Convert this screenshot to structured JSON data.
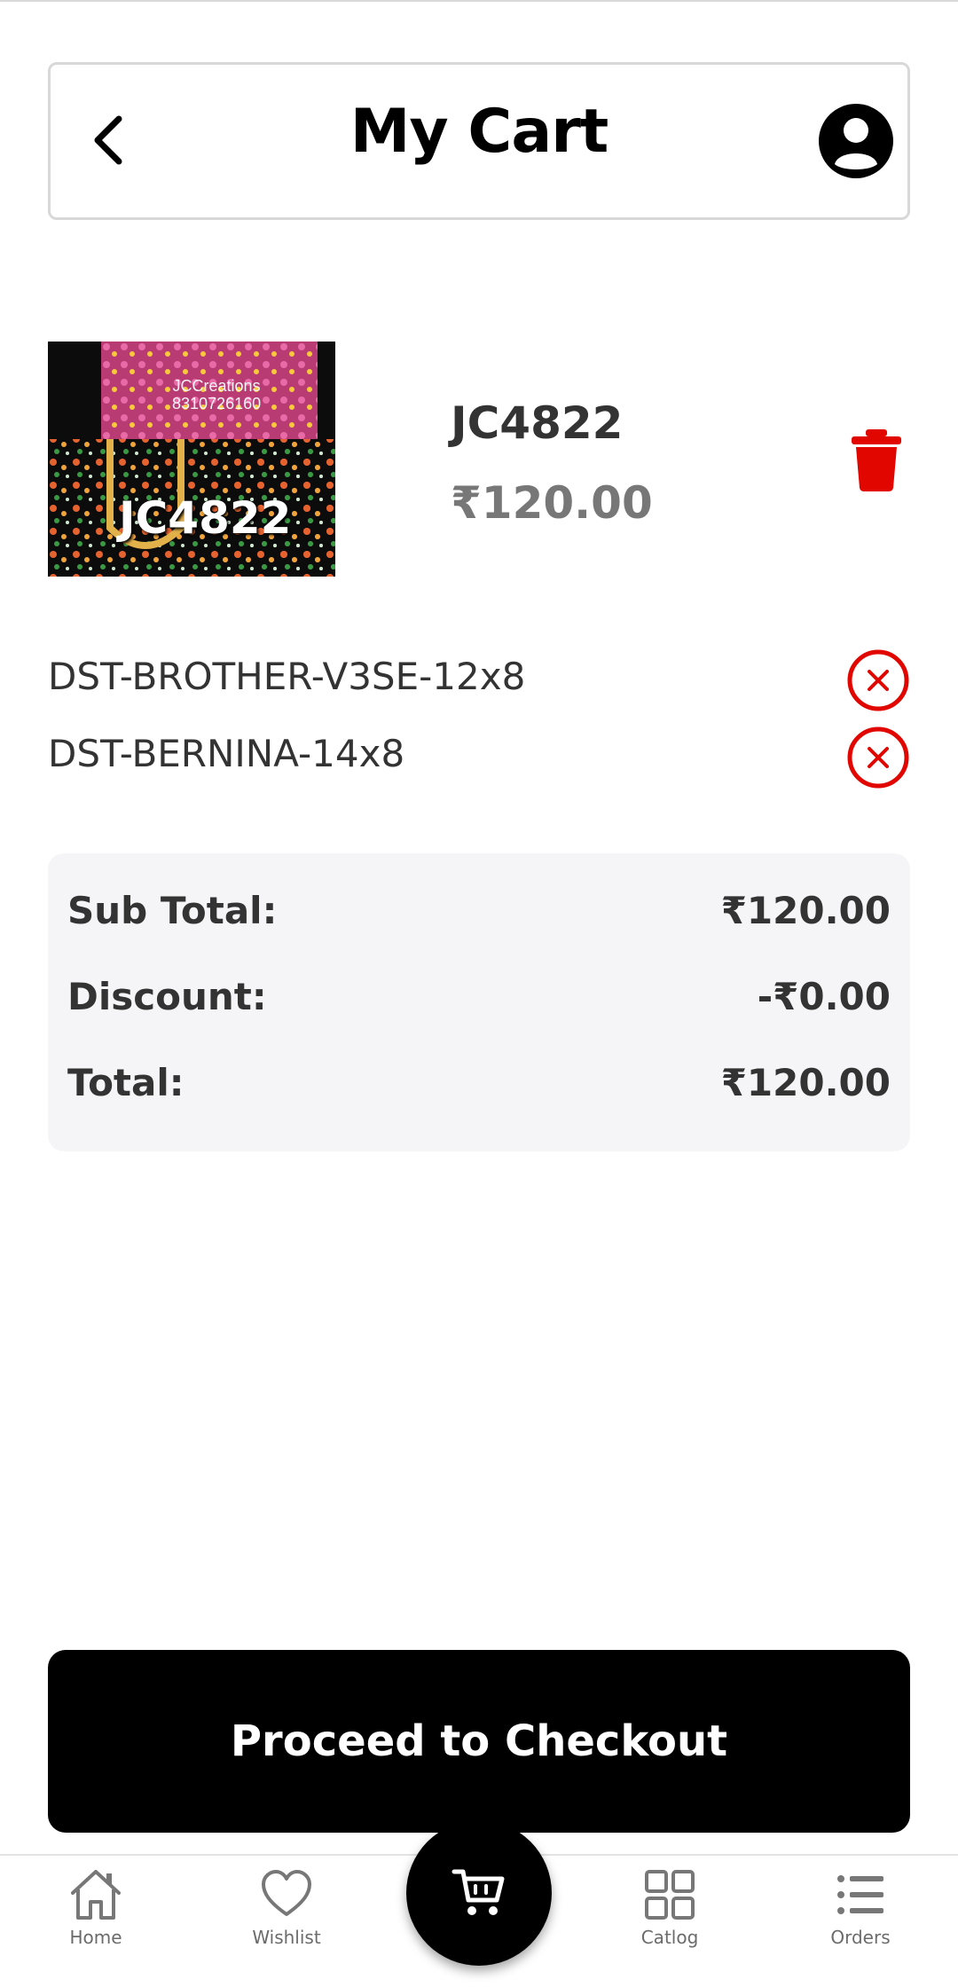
{
  "header": {
    "title": "My Cart"
  },
  "cart_item": {
    "name": "JC4822",
    "price": "₹120.00",
    "image_label": "JC4822",
    "image_watermark_line1": "JCCreations",
    "image_watermark_line2": "8310726160",
    "variants": [
      {
        "label": "DST-BROTHER-V3SE-12x8"
      },
      {
        "label": "DST-BERNINA-14x8"
      }
    ]
  },
  "summary": {
    "subtotal_label": "Sub Total:",
    "subtotal_value": "₹120.00",
    "discount_label": "Discount:",
    "discount_value": "-₹0.00",
    "total_label": "Total:",
    "total_value": "₹120.00"
  },
  "checkout": {
    "label": "Proceed to Checkout"
  },
  "nav": {
    "items": [
      {
        "label": "Home",
        "icon": "home-icon"
      },
      {
        "label": "Wishlist",
        "icon": "heart-icon"
      },
      {
        "label": "",
        "icon": "cart-icon"
      },
      {
        "label": "Catlog",
        "icon": "grid-icon"
      },
      {
        "label": "Orders",
        "icon": "list-icon"
      }
    ]
  },
  "colors": {
    "accent": "#000000",
    "delete": "#e10600",
    "summary_bg": "#f5f5f7"
  }
}
